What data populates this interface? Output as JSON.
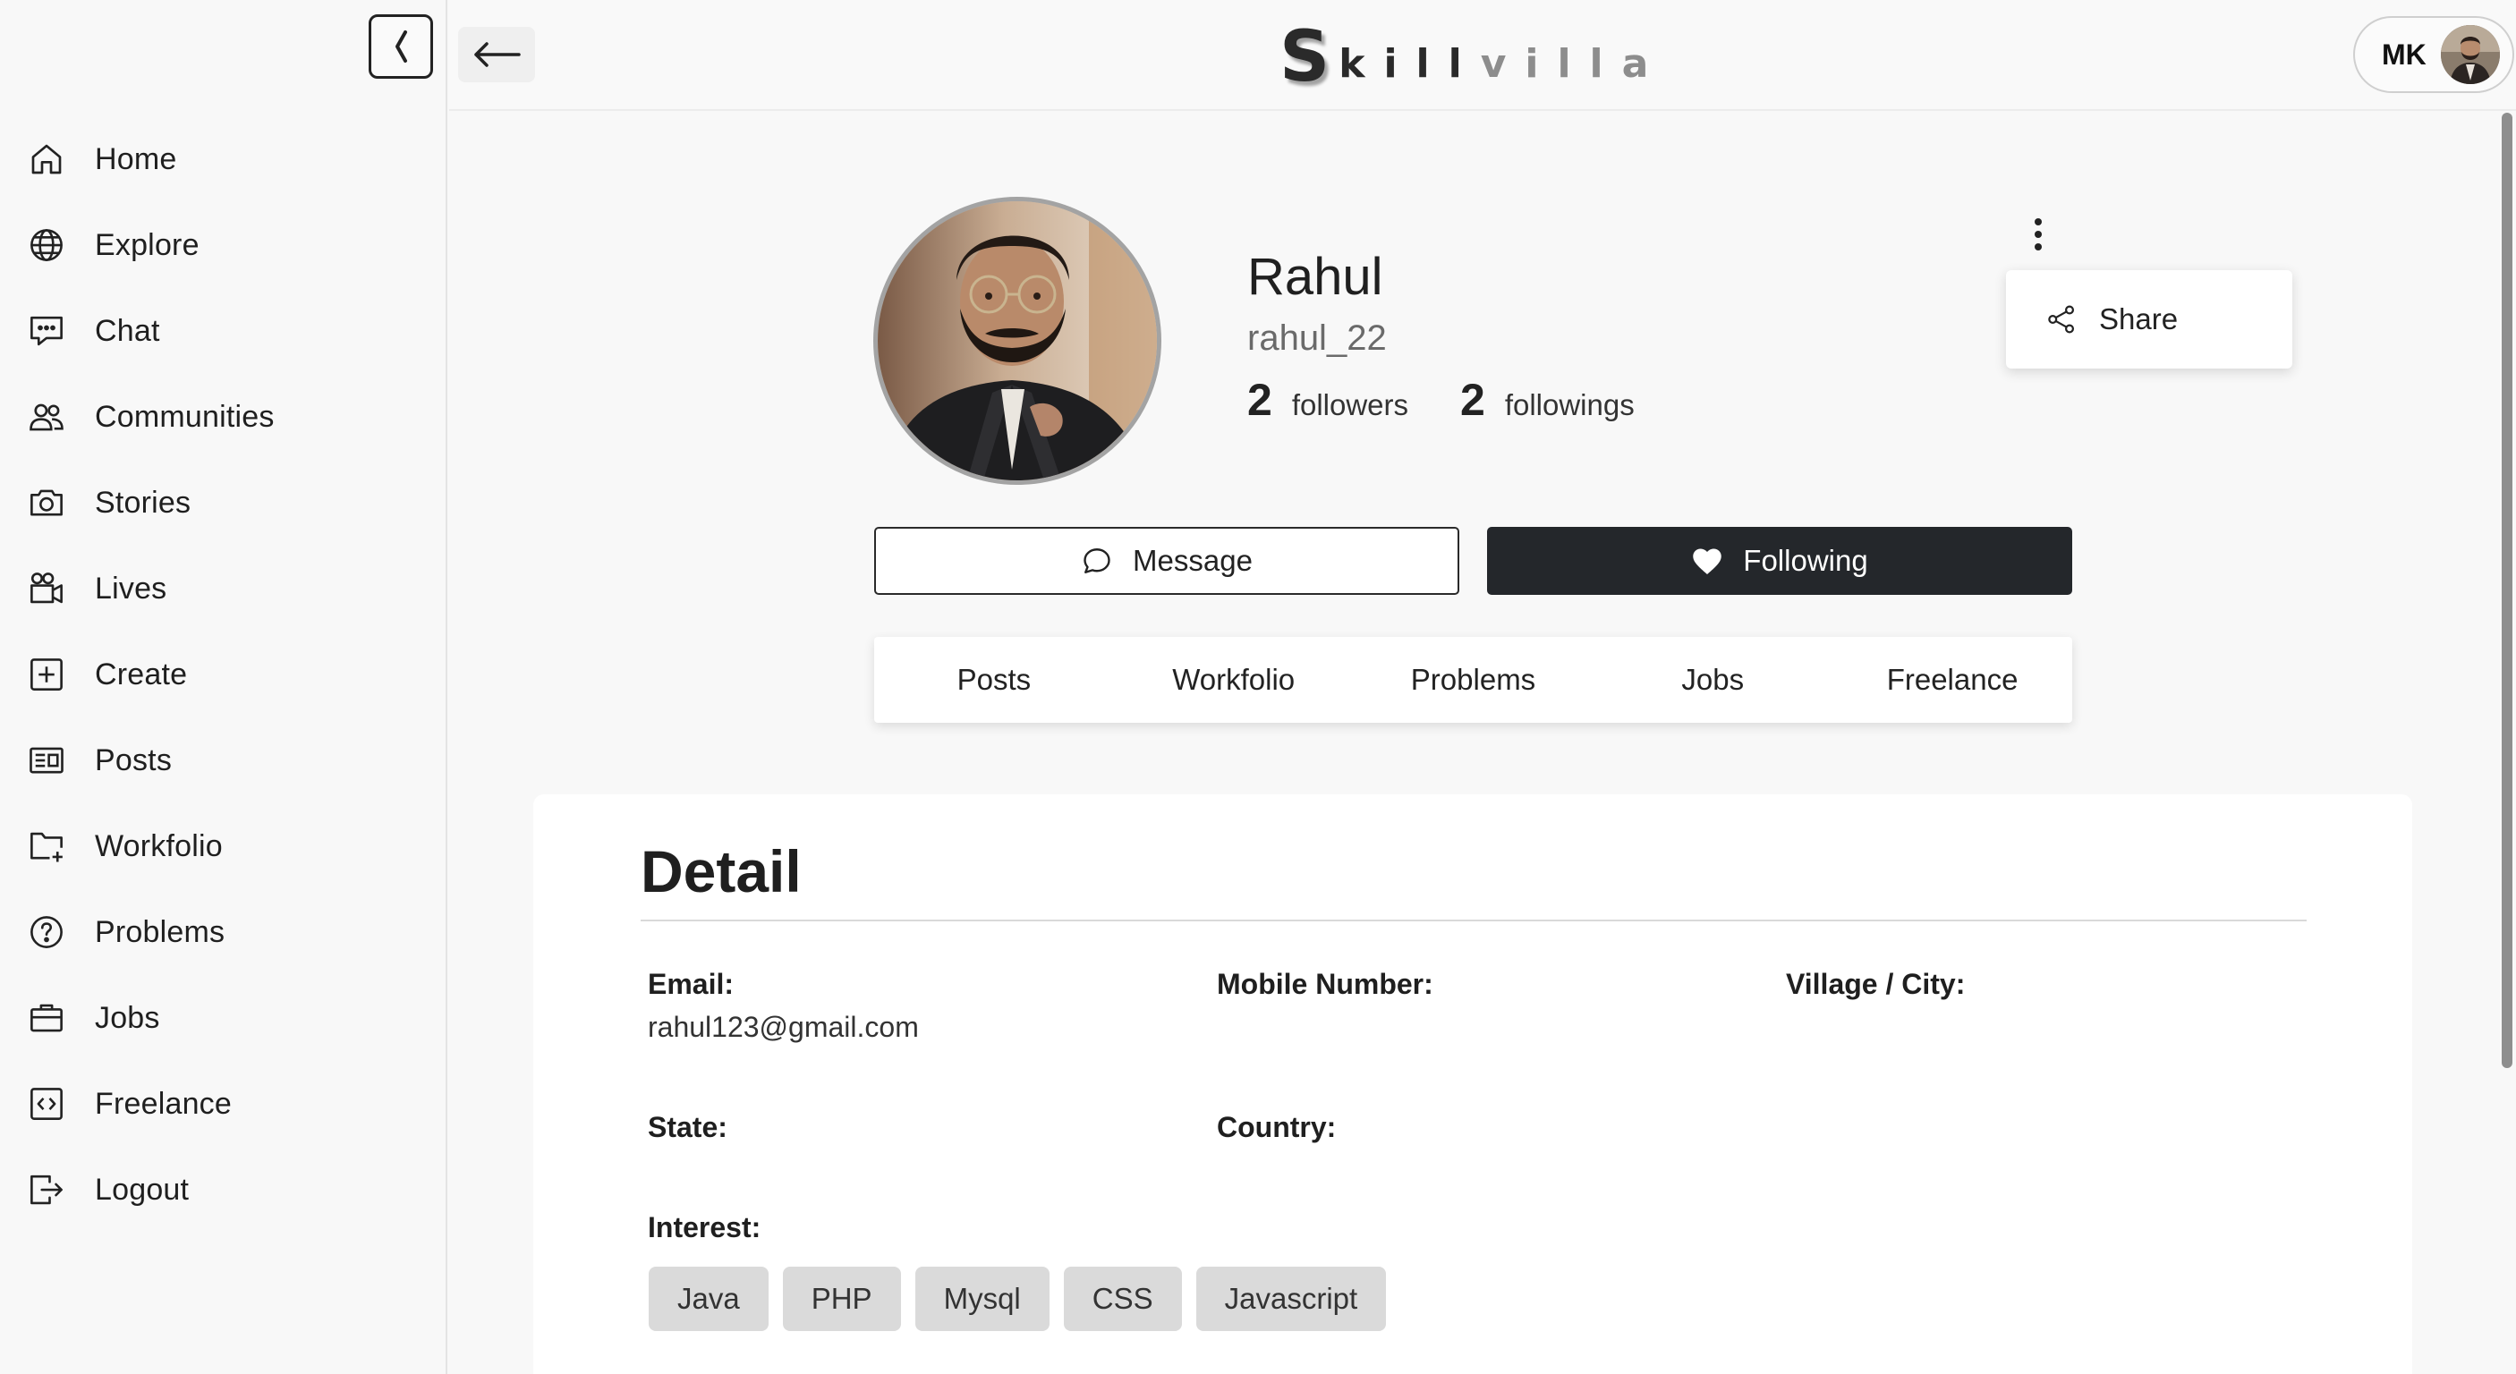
{
  "sidebar": {
    "items": [
      {
        "label": "Home",
        "icon": "home-icon"
      },
      {
        "label": "Explore",
        "icon": "globe-icon"
      },
      {
        "label": "Chat",
        "icon": "chat-icon"
      },
      {
        "label": "Communities",
        "icon": "users-icon"
      },
      {
        "label": "Stories",
        "icon": "camera-icon"
      },
      {
        "label": "Lives",
        "icon": "video-icon"
      },
      {
        "label": "Create",
        "icon": "plus-square-icon"
      },
      {
        "label": "Posts",
        "icon": "newspaper-icon"
      },
      {
        "label": "Workfolio",
        "icon": "folder-plus-icon"
      },
      {
        "label": "Problems",
        "icon": "question-circle-icon"
      },
      {
        "label": "Jobs",
        "icon": "briefcase-icon"
      },
      {
        "label": "Freelance",
        "icon": "code-square-icon"
      },
      {
        "label": "Logout",
        "icon": "logout-icon"
      }
    ]
  },
  "header": {
    "logo_first": "S",
    "logo_dark": "kill",
    "logo_light": "villa",
    "user_initials": "MK"
  },
  "profile": {
    "name": "Rahul",
    "username": "rahul_22",
    "followers_count": "2",
    "followers_label": "followers",
    "followings_count": "2",
    "followings_label": "followings",
    "share_label": "Share",
    "message_label": "Message",
    "following_label": "Following"
  },
  "tabs": [
    "Posts",
    "Workfolio",
    "Problems",
    "Jobs",
    "Freelance"
  ],
  "detail": {
    "title": "Detail",
    "email_label": "Email:",
    "email_value": "rahul123@gmail.com",
    "mobile_label": "Mobile Number:",
    "city_label": "Village / City:",
    "state_label": "State:",
    "country_label": "Country:",
    "interest_label": "Interest:",
    "interests": [
      "Java",
      "PHP",
      "Mysql",
      "CSS",
      "Javascript"
    ]
  },
  "colors": {
    "accent_dark": "#24272b",
    "background": "#f8f8f8",
    "chip": "#dadada",
    "logo_light": "#8d8d8d"
  }
}
